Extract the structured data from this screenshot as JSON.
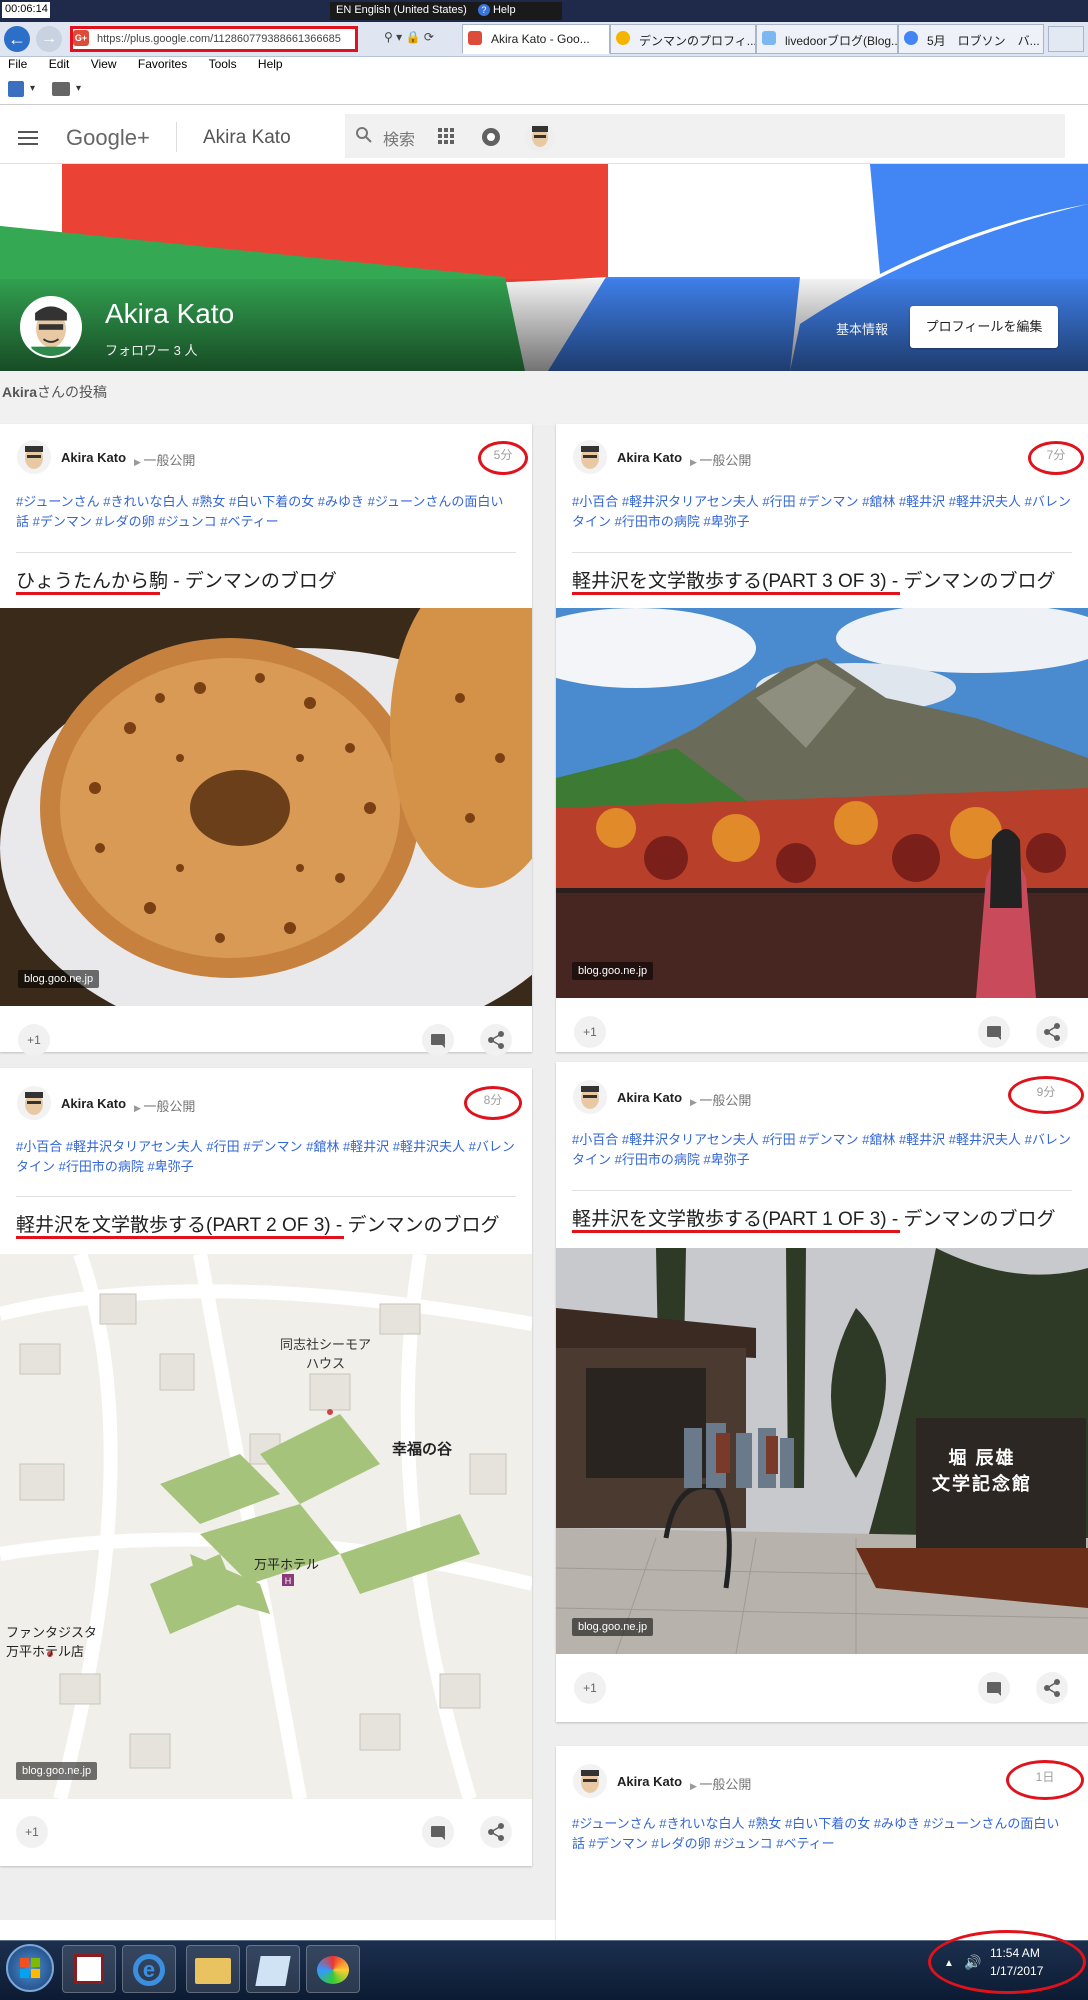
{
  "system": {
    "clock_top": "00:06:14",
    "language": "EN English (United States)",
    "help": "Help"
  },
  "browser": {
    "url": "https://plus.google.com/112860779388661366685",
    "tabs": [
      {
        "label": "Akira Kato - Goo...",
        "active": true,
        "icon": "google-plus-icon"
      },
      {
        "label": "デンマンのプロフィ...",
        "active": false,
        "icon": "ie-icon"
      },
      {
        "label": "livedoorブログ(Blog...",
        "active": false,
        "icon": "livedoor-icon"
      },
      {
        "label": "5月　ロブソン　バ...",
        "active": false,
        "icon": "google-icon"
      }
    ],
    "menu": [
      "File",
      "Edit",
      "View",
      "Favorites",
      "Tools",
      "Help"
    ]
  },
  "gplus_header": {
    "logo": "Google+",
    "profile_name": "Akira Kato",
    "search_placeholder": "検索"
  },
  "profile": {
    "name": "Akira Kato",
    "followers": "フォロワー 3 人",
    "about_link": "基本情報",
    "edit_button": "プロフィールを編集",
    "posts_label_name": "Akira",
    "posts_label_suffix": "さんの投稿"
  },
  "posts": [
    {
      "author": "Akira Kato",
      "visibility": "一般公開",
      "time": "5分",
      "tags": "#ジューンさん #きれいな白人 #熟女 #白い下着の女 #みゆき #ジューンさんの面白い話 #デンマン #レダの卵 #ジュンコ #ベティー",
      "title_main": "ひょうたんから駒",
      "title_suffix": " - デンマンのブログ",
      "source": "blog.goo.ne.jp",
      "plus_one": "+1"
    },
    {
      "author": "Akira Kato",
      "visibility": "一般公開",
      "time": "7分",
      "tags": "#小百合 #軽井沢タリアセン夫人 #行田 #デンマン #舘林 #軽井沢 #軽井沢夫人 #バレンタイン #行田市の病院 #卑弥子",
      "title_main": "軽井沢を文学散歩する(PART 3 OF 3)",
      "title_suffix": " - デンマンのブログ",
      "source": "blog.goo.ne.jp",
      "plus_one": "+1"
    },
    {
      "author": "Akira Kato",
      "visibility": "一般公開",
      "time": "8分",
      "tags": "#小百合 #軽井沢タリアセン夫人 #行田 #デンマン #舘林 #軽井沢 #軽井沢夫人 #バレンタイン #行田市の病院 #卑弥子",
      "title_main": "軽井沢を文学散歩する(PART 2 OF 3)",
      "title_suffix": " - デンマンのブログ",
      "source": "blog.goo.ne.jp",
      "plus_one": "+1",
      "map_labels": {
        "doshisha": "同志社シーモア",
        "house": "ハウス",
        "valley": "幸福の谷",
        "hotel": "万平ホテル",
        "fantasista1": "ファンタジスタ",
        "fantasista2": "万平ホテル店"
      }
    },
    {
      "author": "Akira Kato",
      "visibility": "一般公開",
      "time": "9分",
      "tags": "#小百合 #軽井沢タリアセン夫人 #行田 #デンマン #舘林 #軽井沢 #軽井沢夫人 #バレンタイン #行田市の病院 #卑弥子",
      "title_main": "軽井沢を文学散歩する(PART 1 OF 3)",
      "title_suffix": " - デンマンのブログ",
      "source": "blog.goo.ne.jp",
      "plus_one": "+1",
      "sign_line1": "堀 辰雄",
      "sign_line2": "文学記念館"
    },
    {
      "author": "Akira Kato",
      "visibility": "一般公開",
      "time": "1日",
      "tags": "#ジューンさん #きれいな白人 #熟女 #白い下着の女 #みゆき #ジューンさんの面白い話 #デンマン #レダの卵 #ジュンコ #ベティー"
    }
  ],
  "taskbar": {
    "time": "11:54 AM",
    "date": "1/17/2017"
  },
  "colors": {
    "gplus_red": "#dd4b39",
    "annotation_red": "#e0121b",
    "tag_blue": "#3367d6"
  }
}
